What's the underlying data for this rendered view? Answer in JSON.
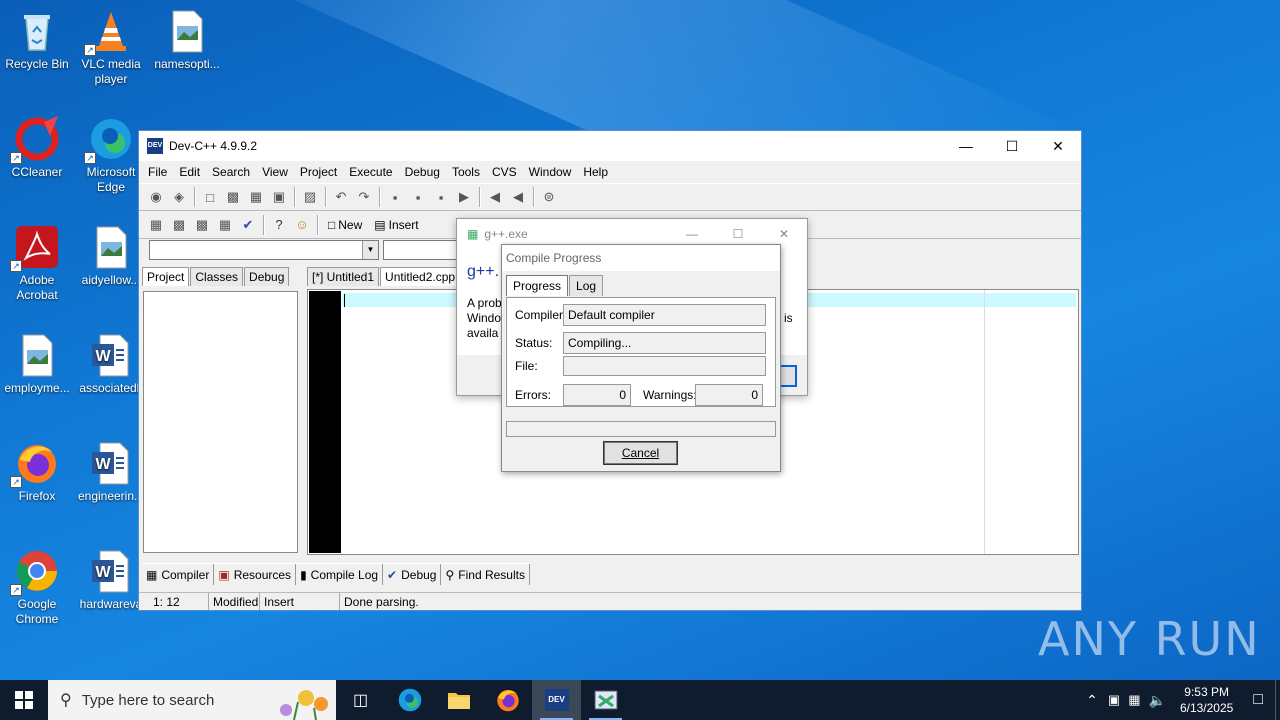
{
  "desktop": {
    "icons": [
      {
        "label": "Recycle Bin"
      },
      {
        "label": "VLC media player"
      },
      {
        "label": "namesopti..."
      },
      {
        "label": "CCleaner"
      },
      {
        "label": "Microsoft Edge"
      },
      {
        "label": "Adobe Acrobat"
      },
      {
        "label": "aidyellow..."
      },
      {
        "label": "employme..."
      },
      {
        "label": "associatedk"
      },
      {
        "label": "Firefox"
      },
      {
        "label": "engineerin..."
      },
      {
        "label": "Google Chrome"
      },
      {
        "label": "hardwareva"
      }
    ],
    "watermark": "ANY RUN"
  },
  "devcpp": {
    "title": "Dev-C++ 4.9.9.2",
    "menu": [
      "File",
      "Edit",
      "Search",
      "View",
      "Project",
      "Execute",
      "Debug",
      "Tools",
      "CVS",
      "Window",
      "Help"
    ],
    "toolbar_new": "New",
    "toolbar_insert": "Insert",
    "left_tabs": [
      "Project",
      "Classes",
      "Debug"
    ],
    "editor_tabs": [
      "[*] Untitled1",
      "Untitled2.cpp"
    ],
    "bottom_tabs": [
      "Compiler",
      "Resources",
      "Compile Log",
      "Debug",
      "Find Results"
    ],
    "status": {
      "position": "1: 12",
      "modified": "Modified",
      "mode": "Insert",
      "message": "Done parsing."
    }
  },
  "gpp_dialog": {
    "title": "g++.exe",
    "heading": "g++.",
    "body_lines": [
      "A prob",
      "Windo",
      "availa"
    ],
    "body_right": "is"
  },
  "compile_progress": {
    "title": "Compile Progress",
    "tabs": [
      "Progress",
      "Log"
    ],
    "compiler_label": "Compiler:",
    "compiler_value": "Default compiler",
    "status_label": "Status:",
    "status_value": "Compiling...",
    "file_label": "File:",
    "file_value": "",
    "errors_label": "Errors:",
    "errors_value": "0",
    "warnings_label": "Warnings:",
    "warnings_value": "0",
    "progress": 0,
    "cancel": "Cancel"
  },
  "taskbar": {
    "search_placeholder": "Type here to search",
    "time": "9:53 PM",
    "date": "6/13/2025"
  }
}
